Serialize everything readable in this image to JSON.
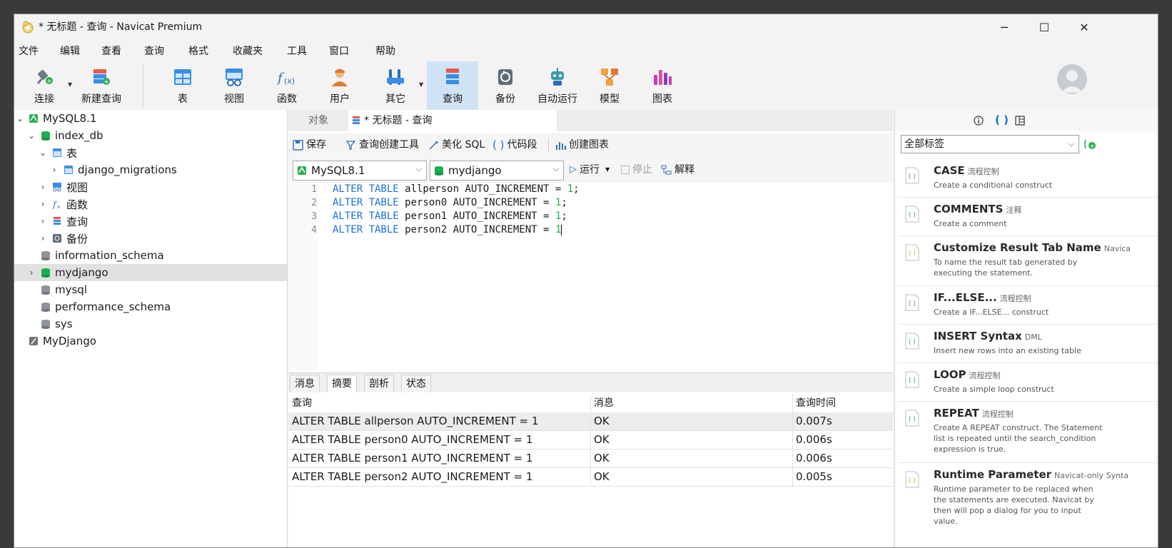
{
  "window": {
    "title": "* 无标题 - 查询 - Navicat Premium",
    "controls": {
      "minimize": "─",
      "maximize": "☐",
      "close": "✕"
    }
  },
  "menu": [
    "文件",
    "编辑",
    "查看",
    "查询",
    "格式",
    "收藏夹",
    "工具",
    "窗口",
    "帮助"
  ],
  "toolbar": {
    "connect": "连接",
    "new_query": "新建查询",
    "table": "表",
    "view": "视图",
    "function": "函数",
    "user": "用户",
    "other": "其它",
    "query": "查询",
    "backup": "备份",
    "automation": "自动运行",
    "model": "模型",
    "chart": "图表"
  },
  "tree": [
    {
      "label": "MySQL8.1"
    },
    {
      "label": "index_db"
    },
    {
      "label": "表"
    },
    {
      "label": "django_migrations"
    },
    {
      "label": "视图"
    },
    {
      "label": "函数"
    },
    {
      "label": "查询"
    },
    {
      "label": "备份"
    },
    {
      "label": "information_schema"
    },
    {
      "label": "mydjango"
    },
    {
      "label": "mysql"
    },
    {
      "label": "performance_schema"
    },
    {
      "label": "sys"
    },
    {
      "label": "MyDjango"
    }
  ],
  "tabs": {
    "objects": "对象",
    "query_tab": "* 无标题 - 查询"
  },
  "editor_toolbar": {
    "save": "保存",
    "query_builder": "查询创建工具",
    "beautify": "美化 SQL",
    "snippet": "代码段",
    "create_chart": "创建图表"
  },
  "run_bar": {
    "connection": "MySQL8.1",
    "database": "mydjango",
    "run": "运行",
    "stop": "停止",
    "explain": "解释"
  },
  "editor": {
    "line_numbers": [
      "1",
      "2",
      "3",
      "4"
    ],
    "lines": [
      {
        "kw": "ALTER TABLE",
        "rest": " allperson AUTO_INCREMENT = ",
        "num": "1",
        "end": ";"
      },
      {
        "kw": "ALTER TABLE",
        "rest": " person0 AUTO_INCREMENT = ",
        "num": "1",
        "end": ";"
      },
      {
        "kw": "ALTER TABLE",
        "rest": " person1 AUTO_INCREMENT = ",
        "num": "1",
        "end": ";"
      },
      {
        "kw": "ALTER TABLE",
        "rest": " person2 AUTO_INCREMENT = ",
        "num": "1",
        "end": ""
      }
    ]
  },
  "result_tabs": [
    "消息",
    "摘要",
    "剖析",
    "状态"
  ],
  "results": {
    "columns": [
      "查询",
      "消息",
      "查询时间"
    ],
    "rows": [
      [
        "ALTER TABLE allperson AUTO_INCREMENT = 1",
        "OK",
        "0.007s"
      ],
      [
        "ALTER TABLE person0 AUTO_INCREMENT = 1",
        "OK",
        "0.006s"
      ],
      [
        "ALTER TABLE person1 AUTO_INCREMENT = 1",
        "OK",
        "0.006s"
      ],
      [
        "ALTER TABLE person2 AUTO_INCREMENT = 1",
        "OK",
        "0.005s"
      ]
    ]
  },
  "snippets": {
    "filter": "全部标签",
    "items": [
      {
        "title": "CASE",
        "tag": "流程控制",
        "desc": "Create a conditional construct"
      },
      {
        "title": "COMMENTS",
        "tag": "注释",
        "desc": "Create a comment"
      },
      {
        "title": "Customize Result Tab Name",
        "tag": "Navica",
        "desc": "To name the result tab generated by executing the statement."
      },
      {
        "title": "IF...ELSE...",
        "tag": "流程控制",
        "desc": "Create a IF...ELSE... construct"
      },
      {
        "title": "INSERT Syntax",
        "tag": "DML",
        "desc": "Insert new rows into an existing table"
      },
      {
        "title": "LOOP",
        "tag": "流程控制",
        "desc": "Create a simple loop construct"
      },
      {
        "title": "REPEAT",
        "tag": "流程控制",
        "desc": "Create A REPEAT construct. The Statement list is repeated until the search_condition expression is true."
      },
      {
        "title": "Runtime Parameter",
        "tag": "Navicat-only Synta",
        "desc": "Runtime parameter to be replaced when the statements are executed. Navicat by then will pop a dialog for you to input value."
      }
    ]
  },
  "colors": {
    "accent": "#1a6fd6",
    "number": "#1fae4b",
    "active_tool": "#cfe3f5",
    "db_green": "#1cae52"
  }
}
